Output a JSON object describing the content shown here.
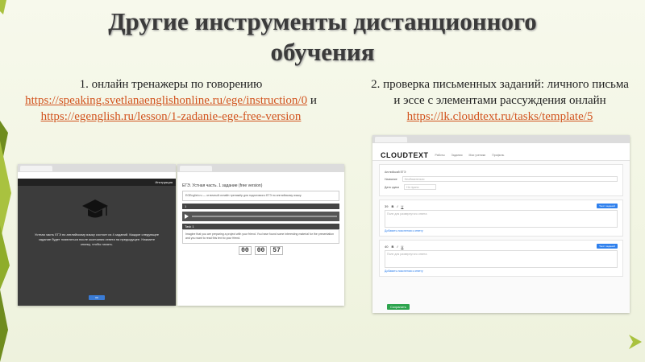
{
  "slide": {
    "title": "Другие инструменты дистанционного обучения",
    "colors": {
      "accent": "#d2541f",
      "deco": "#a9c23f",
      "deco_dark": "#6f8c1e"
    }
  },
  "left": {
    "heading": "1. онлайн тренажеры по говорению",
    "link1": "https://speaking.svetlanaenglishonline.ru/ege/instruction/0",
    "joiner": "и",
    "link2": "https://egenglish.ru/lesson/1-zadanie-ege-free-version"
  },
  "right": {
    "text": "2. проверка письменных заданий: личного письма и эссе с элементами рассуждения онлайн",
    "link": "https://lk.cloudtext.ru/tasks/template/5"
  },
  "shot1": {
    "header_right": "Инструкция",
    "icon": "graduation-cap-icon",
    "message": "Устная часть ЕГЭ по английскому языку состоит из 4 заданий. Каждое следующее задание будет появляться после окончания ответа на предыдущее. Нажмите кнопку, чтобы начать.",
    "button": "ОК"
  },
  "shot2": {
    "page_title": "ЕГЭ. Устная часть. 1 задание (free version)",
    "intro": "EGEnglish.ru — отличный онлайн тренажёр для подготовки к ЕГЭ по английскому языку.",
    "section": "1",
    "task": "Task 1",
    "task_text": "Imagine that you are preparing a project with your friend. You have found some interesting material for the presentation and you want to read this text to your friend.",
    "timer": [
      "00",
      "00",
      "57"
    ]
  },
  "shot3": {
    "logo": "CLOUDTEXT",
    "nav": [
      "Работы",
      "Задания",
      "Мои ученики",
      "Профиль"
    ],
    "exam": "Английский ЕГЭ",
    "name_label": "Название",
    "name_value": "Необязательно",
    "date_label": "Дата сдачи",
    "date_value": "Не нужно",
    "task_num_1": "39",
    "task_num_2": "40",
    "add_button": "Текст заданий",
    "placeholder": "Поле для развернутого ответа",
    "add_link": "Добавить пояснения к ответу",
    "save_button": "Сохранить"
  }
}
